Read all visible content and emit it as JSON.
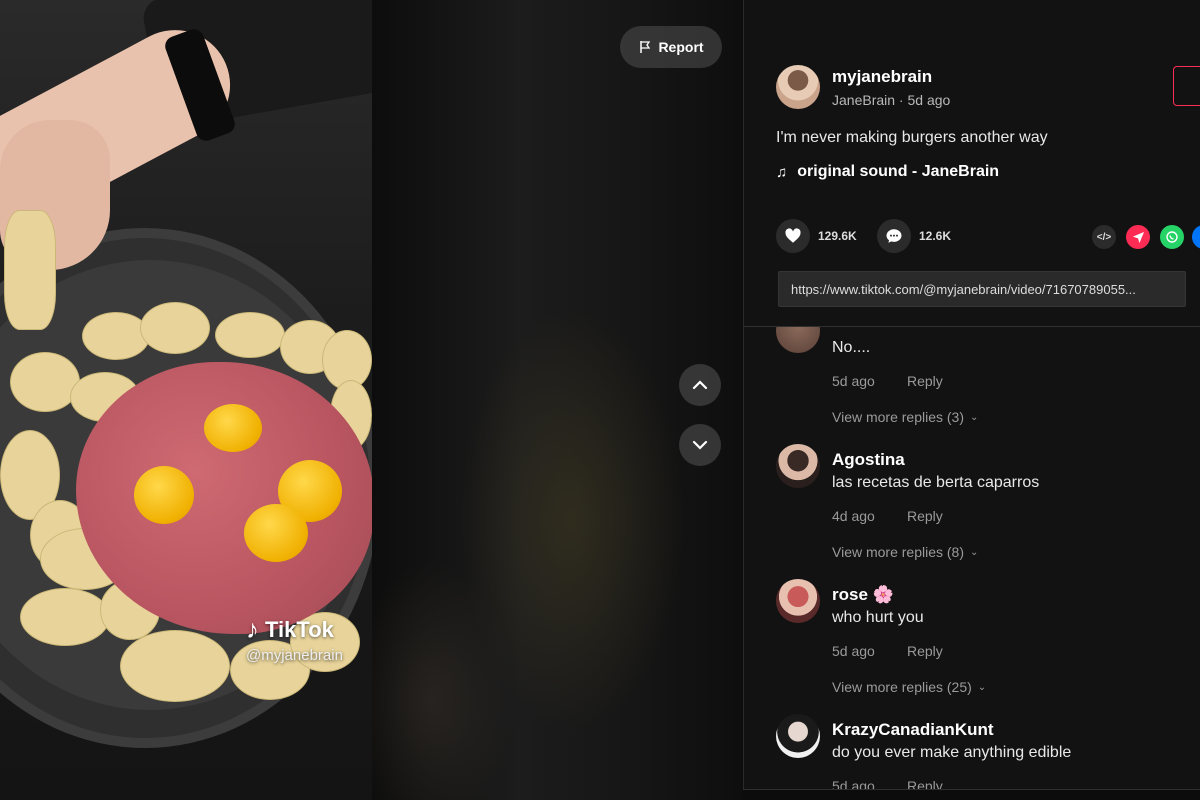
{
  "video": {
    "watermark_brand": "TikTok",
    "watermark_handle": "@myjanebrain",
    "report_label": "Report"
  },
  "author": {
    "username": "myjanebrain",
    "display_line": "JaneBrain · 5d ago",
    "description": "I'm never making burgers another way",
    "sound": "original sound - JaneBrain"
  },
  "stats": {
    "likes": "129.6K",
    "comments": "12.6K"
  },
  "share": {
    "embed_icon": "</>"
  },
  "link": {
    "url": "https://www.tiktok.com/@myjanebrain/video/71670789055..."
  },
  "comments": [
    {
      "name": "",
      "text": "No....",
      "time": "5d ago",
      "reply": "Reply",
      "more": "View more replies (3)"
    },
    {
      "name": "Agostina",
      "text": "las recetas de berta caparros",
      "time": "4d ago",
      "reply": "Reply",
      "more": "View more replies (8)"
    },
    {
      "name": "rose",
      "name_emoji": "🌸",
      "text": "who hurt you",
      "time": "5d ago",
      "reply": "Reply",
      "more": "View more replies (25)"
    },
    {
      "name": "KrazyCanadianKunt",
      "text": "do you ever make anything edible",
      "time": "5d ago",
      "reply": "Reply"
    }
  ],
  "colors": {
    "accent_red": "#fe2c55",
    "whatsapp_green": "#25d366",
    "facebook_blue": "#0075fa",
    "panel_bg": "#121212"
  }
}
